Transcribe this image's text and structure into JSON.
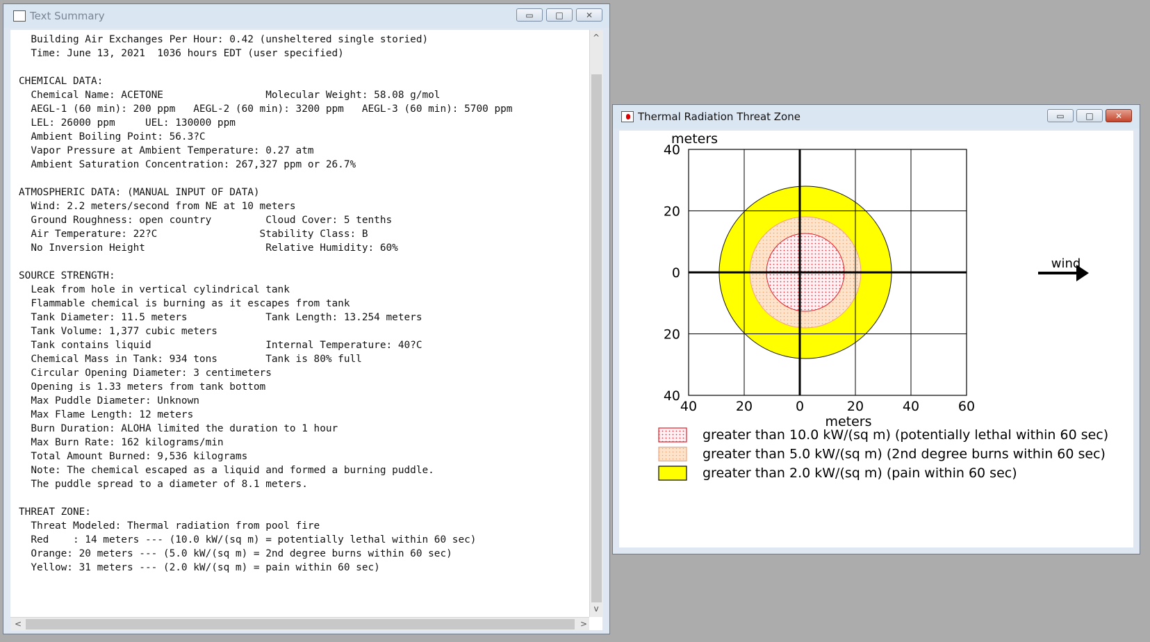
{
  "summary_window": {
    "title": "Text Summary",
    "lines": [
      "  Building Air Exchanges Per Hour: 0.42 (unsheltered single storied)",
      "  Time: June 13, 2021  1036 hours EDT (user specified)",
      "",
      "CHEMICAL DATA:",
      "  Chemical Name: ACETONE                 Molecular Weight: 58.08 g/mol",
      "  AEGL-1 (60 min): 200 ppm   AEGL-2 (60 min): 3200 ppm   AEGL-3 (60 min): 5700 ppm",
      "  LEL: 26000 ppm     UEL: 130000 ppm",
      "  Ambient Boiling Point: 56.3?C",
      "  Vapor Pressure at Ambient Temperature: 0.27 atm",
      "  Ambient Saturation Concentration: 267,327 ppm or 26.7%",
      "",
      "ATMOSPHERIC DATA: (MANUAL INPUT OF DATA)",
      "  Wind: 2.2 meters/second from NE at 10 meters",
      "  Ground Roughness: open country         Cloud Cover: 5 tenths",
      "  Air Temperature: 22?C                 Stability Class: B",
      "  No Inversion Height                    Relative Humidity: 60%",
      "",
      "SOURCE STRENGTH:",
      "  Leak from hole in vertical cylindrical tank",
      "  Flammable chemical is burning as it escapes from tank",
      "  Tank Diameter: 11.5 meters             Tank Length: 13.254 meters",
      "  Tank Volume: 1,377 cubic meters",
      "  Tank contains liquid                   Internal Temperature: 40?C",
      "  Chemical Mass in Tank: 934 tons        Tank is 80% full",
      "  Circular Opening Diameter: 3 centimeters",
      "  Opening is 1.33 meters from tank bottom",
      "  Max Puddle Diameter: Unknown",
      "  Max Flame Length: 12 meters",
      "  Burn Duration: ALOHA limited the duration to 1 hour",
      "  Max Burn Rate: 162 kilograms/min",
      "  Total Amount Burned: 9,536 kilograms",
      "  Note: The chemical escaped as a liquid and formed a burning puddle.",
      "  The puddle spread to a diameter of 8.1 meters.",
      "",
      "THREAT ZONE:",
      "  Threat Modeled: Thermal radiation from pool fire",
      "  Red    : 14 meters --- (10.0 kW/(sq m) = potentially lethal within 60 sec)",
      "  Orange: 20 meters --- (5.0 kW/(sq m) = 2nd degree burns within 60 sec)",
      "  Yellow: 31 meters --- (2.0 kW/(sq m) = pain within 60 sec)"
    ],
    "scroll": {
      "up": "^",
      "down": "v",
      "left": "<",
      "right": ">"
    }
  },
  "threat_window": {
    "title": "Thermal Radiation Threat Zone",
    "chart": {
      "y_unit": "meters",
      "x_unit": "meters",
      "y_ticks": [
        "40",
        "20",
        "0",
        "20",
        "40"
      ],
      "x_ticks": [
        "40",
        "20",
        "0",
        "20",
        "40",
        "60"
      ],
      "wind_label": "wind",
      "zones": [
        {
          "radius_m": 31,
          "color": "#ffff00"
        },
        {
          "radius_m": 20,
          "color": "#fbdcc0"
        },
        {
          "radius_m": 14,
          "color": "#ffe9ef"
        }
      ],
      "x_range": [
        -40,
        60
      ],
      "y_range": [
        -40,
        40
      ],
      "center_x_m": 2
    },
    "legend": [
      {
        "text": "greater than 10.0 kW/(sq m) (potentially lethal within 60 sec)",
        "color": "#ffe9ef"
      },
      {
        "text": "greater than 5.0 kW/(sq m) (2nd degree burns within 60 sec)",
        "color": "#fbdcc0"
      },
      {
        "text": "greater than 2.0 kW/(sq m) (pain within 60 sec)",
        "color": "#ffff00"
      }
    ]
  },
  "window_buttons": {
    "minimize": "▭",
    "maximize": "□",
    "close": "✕"
  }
}
